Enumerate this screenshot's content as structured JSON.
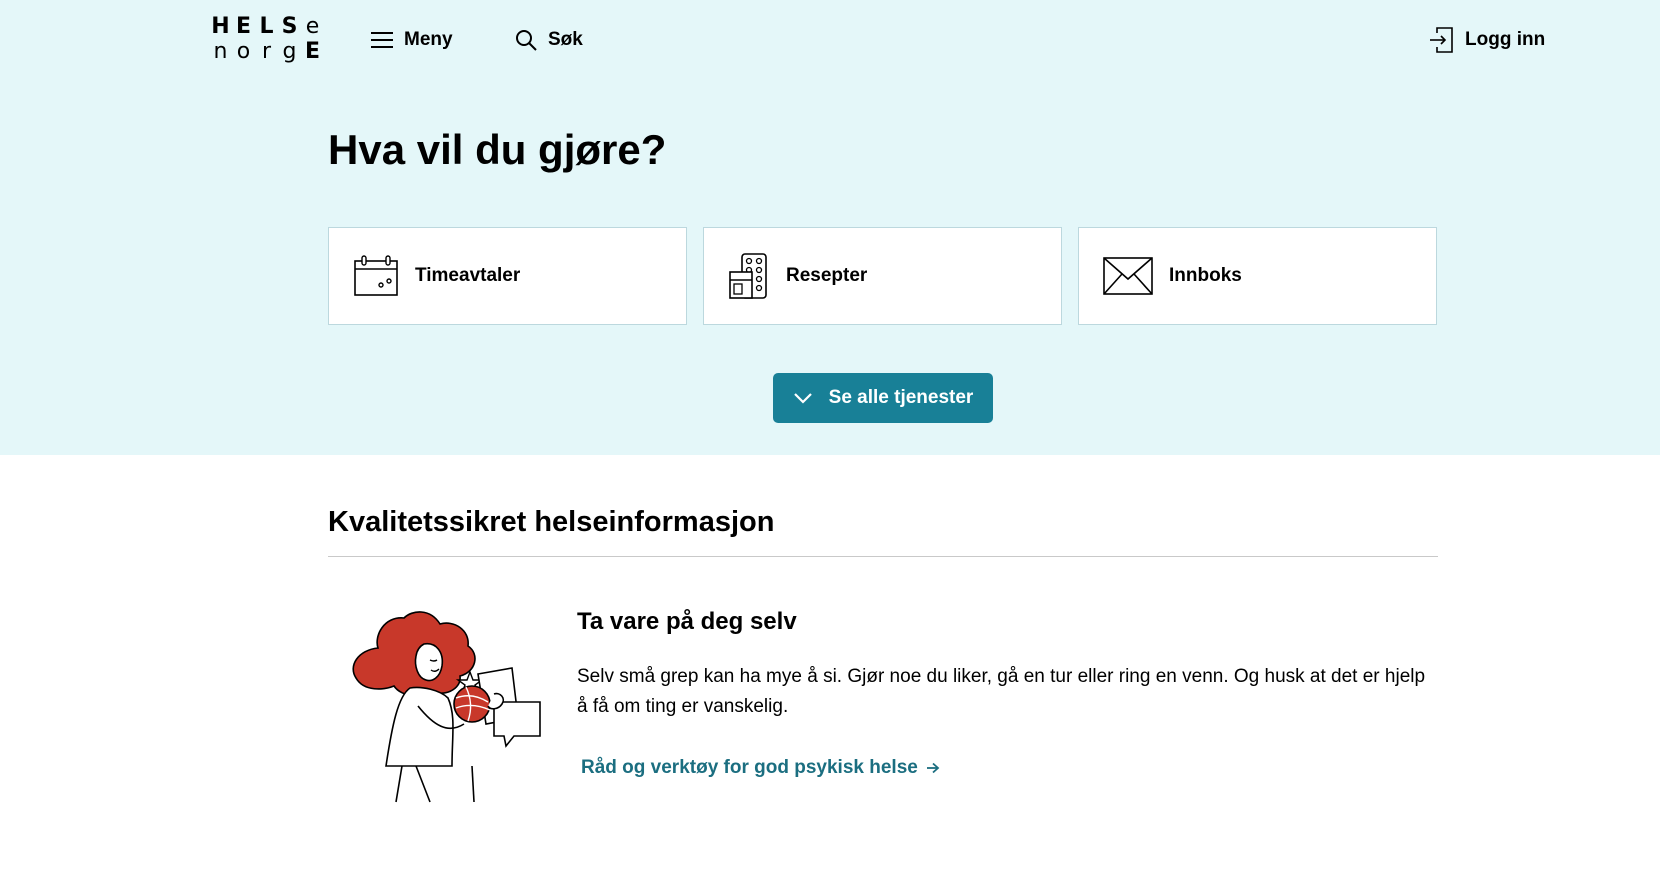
{
  "header": {
    "logo": {
      "row1": [
        "H",
        "E",
        "L",
        "S",
        "e"
      ],
      "row2": [
        "n",
        "o",
        "r",
        "g",
        "E"
      ]
    },
    "menu_label": "Meny",
    "search_label": "Søk",
    "login_label": "Logg inn"
  },
  "hero": {
    "title": "Hva vil du gjøre?",
    "cards": [
      {
        "label": "Timeavtaler",
        "icon": "calendar-icon"
      },
      {
        "label": "Resepter",
        "icon": "prescription-icon"
      },
      {
        "label": "Innboks",
        "icon": "envelope-icon"
      }
    ],
    "see_all_label": "Se alle tjenester"
  },
  "section": {
    "title": "Kvalitetssikret helseinformasjon",
    "article": {
      "title": "Ta vare på deg selv",
      "text": "Selv små grep kan ha mye å si. Gjør noe du liker, gå en tur eller ring en venn. Og husk at det er hjelp å få om ting er vanskelig.",
      "link_label": "Råd og verktøy for god psykisk helse"
    }
  },
  "colors": {
    "hero_background": "#e4f7f9",
    "primary_button": "#188097",
    "link": "#1b6e80",
    "illustration_hair": "#c8382a"
  }
}
